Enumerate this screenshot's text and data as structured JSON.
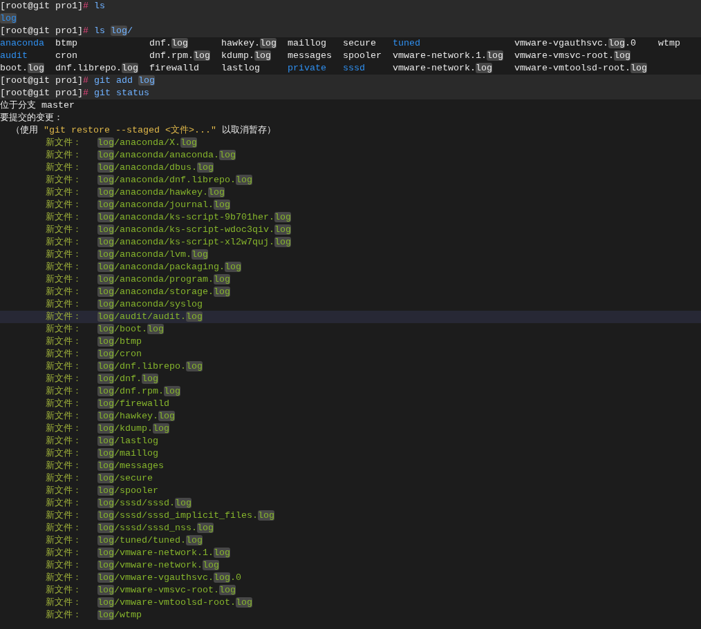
{
  "terminal": {
    "lines": [
      {
        "kind": "prompt",
        "shaded": true,
        "selected": false,
        "prompt": "[root@git pro1]",
        "sign": "#",
        "command": [
          {
            "text": " ls",
            "highlighted": false
          }
        ]
      },
      {
        "kind": "text",
        "shaded": true,
        "selected": false,
        "segments": [
          {
            "text": "log",
            "color": "#2f8fef",
            "highlighted": true
          }
        ]
      },
      {
        "kind": "prompt",
        "shaded": true,
        "selected": false,
        "prompt": "[root@git pro1]",
        "sign": "#",
        "command": [
          {
            "text": " ls ",
            "highlighted": false
          },
          {
            "text": "log",
            "highlighted": true
          },
          {
            "text": "/",
            "highlighted": false
          }
        ]
      },
      {
        "kind": "columns",
        "shaded": false,
        "selected": false,
        "cells": [
          {
            "color": "#2f8fef",
            "segments": [
              {
                "text": "anaconda",
                "highlighted": false
              }
            ]
          },
          {
            "color": "#e8e8e8",
            "segments": [
              {
                "text": "btmp",
                "highlighted": false
              }
            ]
          },
          {
            "color": "#e8e8e8",
            "segments": [
              {
                "text": "dnf.",
                "highlighted": false
              },
              {
                "text": "log",
                "highlighted": true
              }
            ]
          },
          {
            "color": "#e8e8e8",
            "segments": [
              {
                "text": "hawkey.",
                "highlighted": false
              },
              {
                "text": "log",
                "highlighted": true
              }
            ]
          },
          {
            "color": "#e8e8e8",
            "segments": [
              {
                "text": "maillog",
                "highlighted": false
              }
            ]
          },
          {
            "color": "#e8e8e8",
            "segments": [
              {
                "text": "secure",
                "highlighted": false
              }
            ]
          },
          {
            "color": "#2f8fef",
            "segments": [
              {
                "text": "tuned",
                "highlighted": false
              }
            ]
          },
          {
            "color": "#e8e8e8",
            "segments": [
              {
                "text": "vmware-vgauthsvc.",
                "highlighted": false
              },
              {
                "text": "log",
                "highlighted": true
              },
              {
                "text": ".0",
                "highlighted": false
              }
            ]
          },
          {
            "color": "#e8e8e8",
            "segments": [
              {
                "text": "wtmp",
                "highlighted": false
              }
            ]
          }
        ]
      },
      {
        "kind": "columns",
        "shaded": false,
        "selected": false,
        "cells": [
          {
            "color": "#2f8fef",
            "segments": [
              {
                "text": "audit",
                "highlighted": false
              }
            ]
          },
          {
            "color": "#e8e8e8",
            "segments": [
              {
                "text": "cron",
                "highlighted": false
              }
            ]
          },
          {
            "color": "#e8e8e8",
            "segments": [
              {
                "text": "dnf.rpm.",
                "highlighted": false
              },
              {
                "text": "log",
                "highlighted": true
              }
            ]
          },
          {
            "color": "#e8e8e8",
            "segments": [
              {
                "text": "kdump.",
                "highlighted": false
              },
              {
                "text": "log",
                "highlighted": true
              }
            ]
          },
          {
            "color": "#e8e8e8",
            "segments": [
              {
                "text": "messages",
                "highlighted": false
              }
            ]
          },
          {
            "color": "#e8e8e8",
            "segments": [
              {
                "text": "spooler",
                "highlighted": false
              }
            ]
          },
          {
            "color": "#e8e8e8",
            "segments": [
              {
                "text": "vmware-network.1.",
                "highlighted": false
              },
              {
                "text": "log",
                "highlighted": true
              }
            ]
          },
          {
            "color": "#e8e8e8",
            "segments": [
              {
                "text": "vmware-vmsvc-root.",
                "highlighted": false
              },
              {
                "text": "log",
                "highlighted": true
              }
            ]
          }
        ]
      },
      {
        "kind": "columns",
        "shaded": false,
        "selected": false,
        "cells": [
          {
            "color": "#e8e8e8",
            "segments": [
              {
                "text": "boot.",
                "highlighted": false
              },
              {
                "text": "log",
                "highlighted": true
              }
            ]
          },
          {
            "color": "#e8e8e8",
            "segments": [
              {
                "text": "dnf.librepo.",
                "highlighted": false
              },
              {
                "text": "log",
                "highlighted": true
              }
            ]
          },
          {
            "color": "#e8e8e8",
            "segments": [
              {
                "text": "firewalld",
                "highlighted": false
              }
            ]
          },
          {
            "color": "#e8e8e8",
            "segments": [
              {
                "text": "lastlog",
                "highlighted": false
              }
            ]
          },
          {
            "color": "#2f8fef",
            "segments": [
              {
                "text": "private",
                "highlighted": false
              }
            ]
          },
          {
            "color": "#2f8fef",
            "segments": [
              {
                "text": "sssd",
                "highlighted": false
              }
            ]
          },
          {
            "color": "#e8e8e8",
            "segments": [
              {
                "text": "vmware-network.",
                "highlighted": false
              },
              {
                "text": "log",
                "highlighted": true
              }
            ]
          },
          {
            "color": "#e8e8e8",
            "segments": [
              {
                "text": "vmware-vmtoolsd-root.",
                "highlighted": false
              },
              {
                "text": "log",
                "highlighted": true
              }
            ]
          }
        ]
      },
      {
        "kind": "prompt",
        "shaded": true,
        "selected": false,
        "prompt": "[root@git pro1]",
        "sign": "#",
        "command": [
          {
            "text": " git add ",
            "highlighted": false
          },
          {
            "text": "log",
            "highlighted": true
          }
        ]
      },
      {
        "kind": "prompt",
        "shaded": true,
        "selected": false,
        "prompt": "[root@git pro1]",
        "sign": "#",
        "command": [
          {
            "text": " git status",
            "highlighted": false
          }
        ]
      },
      {
        "kind": "text",
        "shaded": false,
        "selected": false,
        "segments": [
          {
            "text": "位于分支 master",
            "highlighted": false
          }
        ]
      },
      {
        "kind": "text",
        "shaded": false,
        "selected": false,
        "segments": [
          {
            "text": "要提交的变更：",
            "highlighted": false
          }
        ]
      },
      {
        "kind": "text",
        "shaded": false,
        "selected": false,
        "segments": [
          {
            "text": "  （使用 ",
            "highlighted": false
          },
          {
            "text": "\"git restore --staged <文件>...\"",
            "color": "#e0b84a",
            "highlighted": false
          },
          {
            "text": " 以取消暂存）",
            "highlighted": false
          }
        ]
      },
      {
        "kind": "staged",
        "shaded": false,
        "selected": false,
        "label": "新文件：",
        "path": [
          {
            "text": "log",
            "highlighted": true
          },
          {
            "text": "/anaconda/X.",
            "highlighted": false
          },
          {
            "text": "log",
            "highlighted": true
          }
        ]
      },
      {
        "kind": "staged",
        "shaded": false,
        "selected": false,
        "label": "新文件：",
        "path": [
          {
            "text": "log",
            "highlighted": true
          },
          {
            "text": "/anaconda/anaconda.",
            "highlighted": false
          },
          {
            "text": "log",
            "highlighted": true
          }
        ]
      },
      {
        "kind": "staged",
        "shaded": false,
        "selected": false,
        "label": "新文件：",
        "path": [
          {
            "text": "log",
            "highlighted": true
          },
          {
            "text": "/anaconda/dbus.",
            "highlighted": false
          },
          {
            "text": "log",
            "highlighted": true
          }
        ]
      },
      {
        "kind": "staged",
        "shaded": false,
        "selected": false,
        "label": "新文件：",
        "path": [
          {
            "text": "log",
            "highlighted": true
          },
          {
            "text": "/anaconda/dnf.librepo.",
            "highlighted": false
          },
          {
            "text": "log",
            "highlighted": true
          }
        ]
      },
      {
        "kind": "staged",
        "shaded": false,
        "selected": false,
        "label": "新文件：",
        "path": [
          {
            "text": "log",
            "highlighted": true
          },
          {
            "text": "/anaconda/hawkey.",
            "highlighted": false
          },
          {
            "text": "log",
            "highlighted": true
          }
        ]
      },
      {
        "kind": "staged",
        "shaded": false,
        "selected": false,
        "label": "新文件：",
        "path": [
          {
            "text": "log",
            "highlighted": true
          },
          {
            "text": "/anaconda/journal.",
            "highlighted": false
          },
          {
            "text": "log",
            "highlighted": true
          }
        ]
      },
      {
        "kind": "staged",
        "shaded": false,
        "selected": false,
        "label": "新文件：",
        "path": [
          {
            "text": "log",
            "highlighted": true
          },
          {
            "text": "/anaconda/ks-script-9b701her.",
            "highlighted": false
          },
          {
            "text": "log",
            "highlighted": true
          }
        ]
      },
      {
        "kind": "staged",
        "shaded": false,
        "selected": false,
        "label": "新文件：",
        "path": [
          {
            "text": "log",
            "highlighted": true
          },
          {
            "text": "/anaconda/ks-script-wdoc3qiv.",
            "highlighted": false
          },
          {
            "text": "log",
            "highlighted": true
          }
        ]
      },
      {
        "kind": "staged",
        "shaded": false,
        "selected": false,
        "label": "新文件：",
        "path": [
          {
            "text": "log",
            "highlighted": true
          },
          {
            "text": "/anaconda/ks-script-xl2w7quj.",
            "highlighted": false
          },
          {
            "text": "log",
            "highlighted": true
          }
        ]
      },
      {
        "kind": "staged",
        "shaded": false,
        "selected": false,
        "label": "新文件：",
        "path": [
          {
            "text": "log",
            "highlighted": true
          },
          {
            "text": "/anaconda/lvm.",
            "highlighted": false
          },
          {
            "text": "log",
            "highlighted": true
          }
        ]
      },
      {
        "kind": "staged",
        "shaded": false,
        "selected": false,
        "label": "新文件：",
        "path": [
          {
            "text": "log",
            "highlighted": true
          },
          {
            "text": "/anaconda/packaging.",
            "highlighted": false
          },
          {
            "text": "log",
            "highlighted": true
          }
        ]
      },
      {
        "kind": "staged",
        "shaded": false,
        "selected": false,
        "label": "新文件：",
        "path": [
          {
            "text": "log",
            "highlighted": true
          },
          {
            "text": "/anaconda/program.",
            "highlighted": false
          },
          {
            "text": "log",
            "highlighted": true
          }
        ]
      },
      {
        "kind": "staged",
        "shaded": false,
        "selected": false,
        "label": "新文件：",
        "path": [
          {
            "text": "log",
            "highlighted": true
          },
          {
            "text": "/anaconda/storage.",
            "highlighted": false
          },
          {
            "text": "log",
            "highlighted": true
          }
        ]
      },
      {
        "kind": "staged",
        "shaded": false,
        "selected": false,
        "label": "新文件：",
        "path": [
          {
            "text": "log",
            "highlighted": true
          },
          {
            "text": "/anaconda/syslog",
            "highlighted": false
          }
        ]
      },
      {
        "kind": "staged",
        "shaded": false,
        "selected": true,
        "label": "新文件：",
        "path": [
          {
            "text": "log",
            "highlighted": true
          },
          {
            "text": "/audit/audit.",
            "highlighted": false
          },
          {
            "text": "log",
            "highlighted": true
          }
        ]
      },
      {
        "kind": "staged",
        "shaded": false,
        "selected": false,
        "label": "新文件：",
        "path": [
          {
            "text": "log",
            "highlighted": true
          },
          {
            "text": "/boot.",
            "highlighted": false
          },
          {
            "text": "log",
            "highlighted": true
          }
        ]
      },
      {
        "kind": "staged",
        "shaded": false,
        "selected": false,
        "label": "新文件：",
        "path": [
          {
            "text": "log",
            "highlighted": true
          },
          {
            "text": "/btmp",
            "highlighted": false
          }
        ]
      },
      {
        "kind": "staged",
        "shaded": false,
        "selected": false,
        "label": "新文件：",
        "path": [
          {
            "text": "log",
            "highlighted": true
          },
          {
            "text": "/cron",
            "highlighted": false
          }
        ]
      },
      {
        "kind": "staged",
        "shaded": false,
        "selected": false,
        "label": "新文件：",
        "path": [
          {
            "text": "log",
            "highlighted": true
          },
          {
            "text": "/dnf.librepo.",
            "highlighted": false
          },
          {
            "text": "log",
            "highlighted": true
          }
        ]
      },
      {
        "kind": "staged",
        "shaded": false,
        "selected": false,
        "label": "新文件：",
        "path": [
          {
            "text": "log",
            "highlighted": true
          },
          {
            "text": "/dnf.",
            "highlighted": false
          },
          {
            "text": "log",
            "highlighted": true
          }
        ]
      },
      {
        "kind": "staged",
        "shaded": false,
        "selected": false,
        "label": "新文件：",
        "path": [
          {
            "text": "log",
            "highlighted": true
          },
          {
            "text": "/dnf.rpm.",
            "highlighted": false
          },
          {
            "text": "log",
            "highlighted": true
          }
        ]
      },
      {
        "kind": "staged",
        "shaded": false,
        "selected": false,
        "label": "新文件：",
        "path": [
          {
            "text": "log",
            "highlighted": true
          },
          {
            "text": "/firewalld",
            "highlighted": false
          }
        ]
      },
      {
        "kind": "staged",
        "shaded": false,
        "selected": false,
        "label": "新文件：",
        "path": [
          {
            "text": "log",
            "highlighted": true
          },
          {
            "text": "/hawkey.",
            "highlighted": false
          },
          {
            "text": "log",
            "highlighted": true
          }
        ]
      },
      {
        "kind": "staged",
        "shaded": false,
        "selected": false,
        "label": "新文件：",
        "path": [
          {
            "text": "log",
            "highlighted": true
          },
          {
            "text": "/kdump.",
            "highlighted": false
          },
          {
            "text": "log",
            "highlighted": true
          }
        ]
      },
      {
        "kind": "staged",
        "shaded": false,
        "selected": false,
        "label": "新文件：",
        "path": [
          {
            "text": "log",
            "highlighted": true
          },
          {
            "text": "/lastlog",
            "highlighted": false
          }
        ]
      },
      {
        "kind": "staged",
        "shaded": false,
        "selected": false,
        "label": "新文件：",
        "path": [
          {
            "text": "log",
            "highlighted": true
          },
          {
            "text": "/maillog",
            "highlighted": false
          }
        ]
      },
      {
        "kind": "staged",
        "shaded": false,
        "selected": false,
        "label": "新文件：",
        "path": [
          {
            "text": "log",
            "highlighted": true
          },
          {
            "text": "/messages",
            "highlighted": false
          }
        ]
      },
      {
        "kind": "staged",
        "shaded": false,
        "selected": false,
        "label": "新文件：",
        "path": [
          {
            "text": "log",
            "highlighted": true
          },
          {
            "text": "/secure",
            "highlighted": false
          }
        ]
      },
      {
        "kind": "staged",
        "shaded": false,
        "selected": false,
        "label": "新文件：",
        "path": [
          {
            "text": "log",
            "highlighted": true
          },
          {
            "text": "/spooler",
            "highlighted": false
          }
        ]
      },
      {
        "kind": "staged",
        "shaded": false,
        "selected": false,
        "label": "新文件：",
        "path": [
          {
            "text": "log",
            "highlighted": true
          },
          {
            "text": "/sssd/sssd.",
            "highlighted": false
          },
          {
            "text": "log",
            "highlighted": true
          }
        ]
      },
      {
        "kind": "staged",
        "shaded": false,
        "selected": false,
        "label": "新文件：",
        "path": [
          {
            "text": "log",
            "highlighted": true
          },
          {
            "text": "/sssd/sssd_implicit_files.",
            "highlighted": false
          },
          {
            "text": "log",
            "highlighted": true
          }
        ]
      },
      {
        "kind": "staged",
        "shaded": false,
        "selected": false,
        "label": "新文件：",
        "path": [
          {
            "text": "log",
            "highlighted": true
          },
          {
            "text": "/sssd/sssd_nss.",
            "highlighted": false
          },
          {
            "text": "log",
            "highlighted": true
          }
        ]
      },
      {
        "kind": "staged",
        "shaded": false,
        "selected": false,
        "label": "新文件：",
        "path": [
          {
            "text": "log",
            "highlighted": true
          },
          {
            "text": "/tuned/tuned.",
            "highlighted": false
          },
          {
            "text": "log",
            "highlighted": true
          }
        ]
      },
      {
        "kind": "staged",
        "shaded": false,
        "selected": false,
        "label": "新文件：",
        "path": [
          {
            "text": "log",
            "highlighted": true
          },
          {
            "text": "/vmware-network.1.",
            "highlighted": false
          },
          {
            "text": "log",
            "highlighted": true
          }
        ]
      },
      {
        "kind": "staged",
        "shaded": false,
        "selected": false,
        "label": "新文件：",
        "path": [
          {
            "text": "log",
            "highlighted": true
          },
          {
            "text": "/vmware-network.",
            "highlighted": false
          },
          {
            "text": "log",
            "highlighted": true
          }
        ]
      },
      {
        "kind": "staged",
        "shaded": false,
        "selected": false,
        "label": "新文件：",
        "path": [
          {
            "text": "log",
            "highlighted": true
          },
          {
            "text": "/vmware-vgauthsvc.",
            "highlighted": false
          },
          {
            "text": "log",
            "highlighted": true
          },
          {
            "text": ".0",
            "highlighted": false
          }
        ]
      },
      {
        "kind": "staged",
        "shaded": false,
        "selected": false,
        "label": "新文件：",
        "path": [
          {
            "text": "log",
            "highlighted": true
          },
          {
            "text": "/vmware-vmsvc-root.",
            "highlighted": false
          },
          {
            "text": "log",
            "highlighted": true
          }
        ]
      },
      {
        "kind": "staged",
        "shaded": false,
        "selected": false,
        "label": "新文件：",
        "path": [
          {
            "text": "log",
            "highlighted": true
          },
          {
            "text": "/vmware-vmtoolsd-root.",
            "highlighted": false
          },
          {
            "text": "log",
            "highlighted": true
          }
        ]
      },
      {
        "kind": "staged",
        "shaded": false,
        "selected": false,
        "label": "新文件：",
        "path": [
          {
            "text": "log",
            "highlighted": true
          },
          {
            "text": "/wtmp",
            "highlighted": false
          }
        ]
      }
    ]
  }
}
